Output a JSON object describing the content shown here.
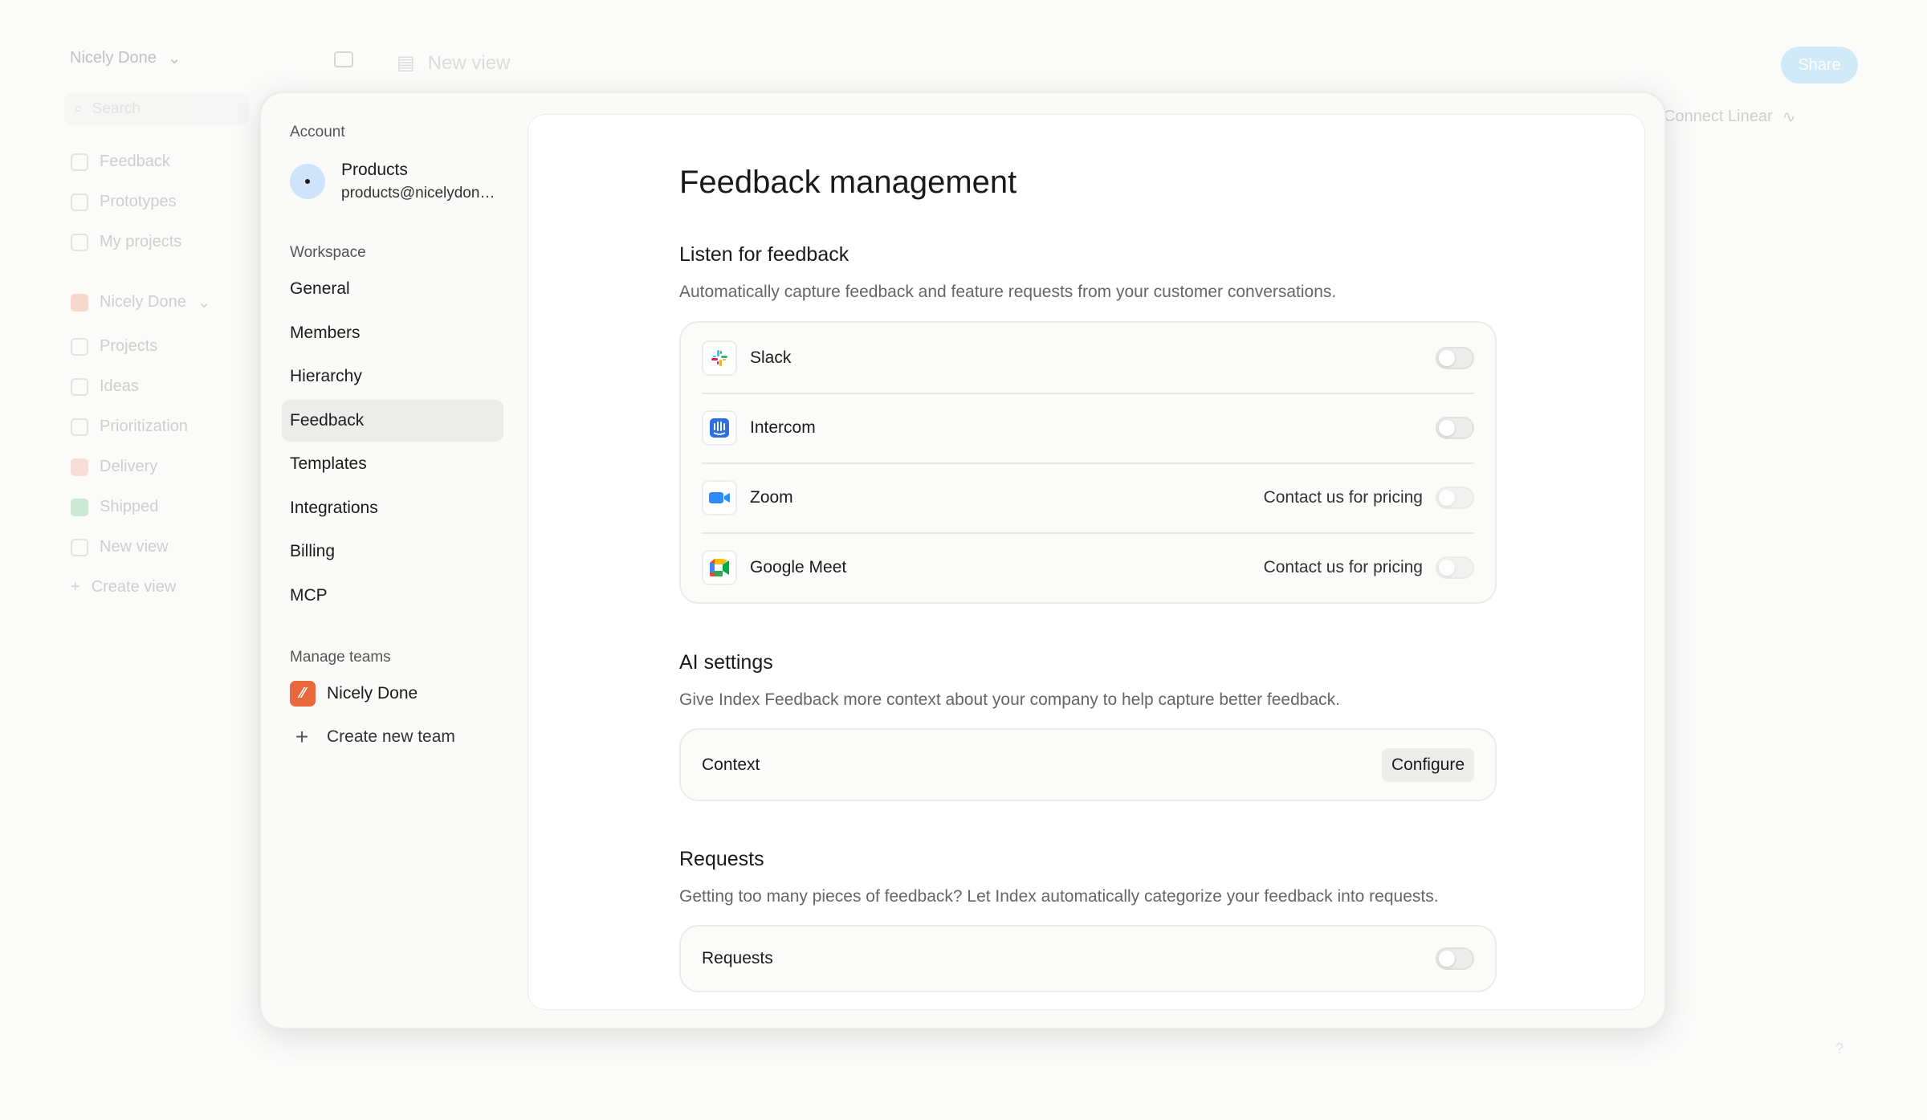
{
  "background": {
    "workspace_name": "Nicely Done",
    "search_placeholder": "Search",
    "nav_top": [
      "Feedback",
      "Prototypes",
      "My projects"
    ],
    "team_name": "Nicely Done",
    "nav_team": [
      "Projects",
      "Ideas",
      "Prioritization",
      "Delivery",
      "Shipped",
      "New view",
      "Create view"
    ],
    "header_view": "New view",
    "share_label": "Share",
    "connect_linear": "Connect Linear",
    "help": "?"
  },
  "settings_sidebar": {
    "account_label": "Account",
    "account_name": "Products",
    "account_email": "products@nicelydone.club",
    "workspace_label": "Workspace",
    "items": [
      {
        "label": "General",
        "active": false
      },
      {
        "label": "Members",
        "active": false
      },
      {
        "label": "Hierarchy",
        "active": false
      },
      {
        "label": "Feedback",
        "active": true
      },
      {
        "label": "Templates",
        "active": false
      },
      {
        "label": "Integrations",
        "active": false
      },
      {
        "label": "Billing",
        "active": false
      },
      {
        "label": "MCP",
        "active": false
      }
    ],
    "teams_label": "Manage teams",
    "team_name": "Nicely Done",
    "create_team": "Create new team"
  },
  "main": {
    "title": "Feedback management",
    "listen": {
      "title": "Listen for feedback",
      "description": "Automatically capture feedback and feature requests from your customer conversations.",
      "integrations": [
        {
          "name": "Slack",
          "icon": "slack-icon",
          "note": "",
          "enabled": false
        },
        {
          "name": "Intercom",
          "icon": "intercom-icon",
          "note": "",
          "enabled": false
        },
        {
          "name": "Zoom",
          "icon": "zoom-icon",
          "note": "Contact us for pricing",
          "enabled": false
        },
        {
          "name": "Google Meet",
          "icon": "google-meet-icon",
          "note": "Contact us for pricing",
          "enabled": false
        }
      ]
    },
    "ai": {
      "title": "AI settings",
      "description": "Give Index Feedback more context about your company to help capture better feedback.",
      "row_label": "Context",
      "button_label": "Configure"
    },
    "requests": {
      "title": "Requests",
      "description": "Getting too many pieces of feedback? Let Index automatically categorize your feedback into requests.",
      "row_label": "Requests",
      "enabled": false
    }
  },
  "colors": {
    "accent_share": "#8fd0f7",
    "team_logo": "#e9683c",
    "avatar": "#cfe3fb",
    "active_nav": "#ececea"
  }
}
